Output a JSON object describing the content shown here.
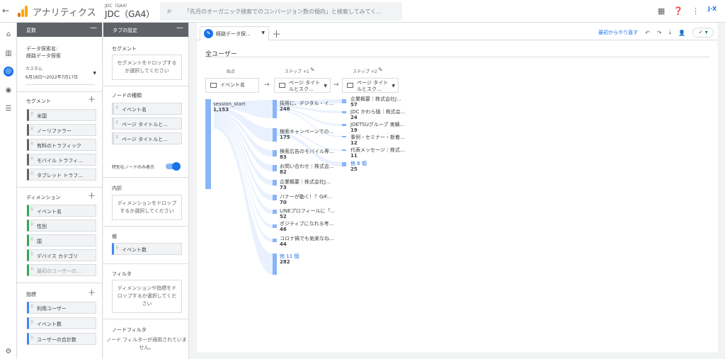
{
  "header": {
    "back": "←",
    "app_title": "アナリティクス",
    "account_small": "JDC（GA4）",
    "account_main": "JDC（GA4）",
    "search_placeholder": "「先月のオーガニック検索でのコンバージョン数の傾向」と検索してみてく...",
    "avatar_text": "J·X"
  },
  "variables": {
    "header": "変数",
    "exploration_name_label": "データ探索名:",
    "exploration_name": "経路データ探索",
    "date_label": "カスタム",
    "date_range": "6月18日～2022年7月17日",
    "segments_label": "セグメント",
    "segments": [
      "米国",
      "ノーリファラー",
      "有料のトラフィック",
      "モバイル トラフィ...",
      "タブレット トラフ..."
    ],
    "dimensions_label": "ディメンション",
    "dimensions": [
      "イベント名",
      "性別",
      "国",
      "デバイス カテゴリ",
      "最初のユーザーの..."
    ],
    "metrics_label": "指標",
    "metrics": [
      "利用ユーザー",
      "イベント数",
      "ユーザーの合計数"
    ]
  },
  "tab_settings": {
    "header": "タブの設定",
    "segment_label": "セグメント",
    "segment_drop": "セグメントをドロップするか選択してください",
    "node_type_label": "ノードの種類",
    "node_types": [
      "イベント名",
      "ページ タイトルと...",
      "ページ タイトルと..."
    ],
    "unique_nodes_label": "特別なノードのみ表示",
    "breakdown_label": "内訳",
    "breakdown_drop": "ディメンションをドロップするか選択してください",
    "values_label": "値",
    "value_item": "イベント数",
    "filters_label": "フィルタ",
    "filters_drop": "ディメンションや指標をドロップするか選択してください",
    "node_filter_label": "ノードフィルタ",
    "node_filter_text": "ノード フィルターが適用されていません。"
  },
  "canvas": {
    "tab_name": "経路データ探...",
    "restart": "最初からやり直す",
    "segment_title": "全ユーザー",
    "status": "✓ ▾",
    "steps": {
      "start_label": "始点",
      "start_select": "イベント名",
      "step1_label": "ステップ +1",
      "step1_select": "ページ タイトルとスク...",
      "step2_label": "ステップ +2",
      "step2_select": "ページ タイトルとスク..."
    },
    "start_node": {
      "label": "session_start",
      "value": "1,153"
    },
    "step1_nodes": [
      {
        "label": "採用に、デジタル・イ...",
        "value": "246"
      },
      {
        "label": "検索キャンペーンでの...",
        "value": "175"
      },
      {
        "label": "検索広告のモバイル専...",
        "value": "83"
      },
      {
        "label": "お問い合わせ｜株式会...",
        "value": "82"
      },
      {
        "label": "企業概要｜株式会社J...",
        "value": "73"
      },
      {
        "label": "バナーが動く！？GIF...",
        "value": "70"
      },
      {
        "label": "LINEプロフィールに「...",
        "value": "52"
      },
      {
        "label": "ポジティブになれる考...",
        "value": "46"
      },
      {
        "label": "コロナ禍でも気楽なね...",
        "value": "44"
      },
      {
        "label": "他 11 個",
        "value": "282"
      }
    ],
    "step2_nodes": [
      {
        "label": "企業概要｜株式会社J...",
        "value": "57"
      },
      {
        "label": "JDC かわら版｜株式会...",
        "value": "24"
      },
      {
        "label": "JOETSUグループ 実績...",
        "value": "19"
      },
      {
        "label": "事例・セミナー・新着...",
        "value": "12"
      },
      {
        "label": "代表メッセージ｜株式...",
        "value": "11"
      },
      {
        "label": "他 6 個",
        "value": "25"
      }
    ]
  }
}
